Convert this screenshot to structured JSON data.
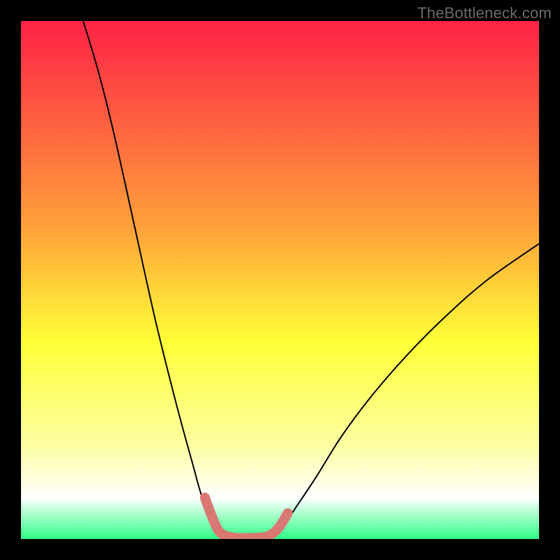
{
  "watermark": "TheBottleneck.com",
  "chart_data": {
    "type": "line",
    "title": "",
    "xlabel": "",
    "ylabel": "",
    "xlim": [
      0,
      100
    ],
    "ylim": [
      0,
      100
    ],
    "background_gradient": {
      "top": "#fe2245",
      "mid1": "#ffa23a",
      "mid2": "#ffff37",
      "mid3": "#fdffa2",
      "bottom": "#2eff86"
    },
    "series": [
      {
        "name": "curve",
        "color": "#000000",
        "stroke_width": 2,
        "points": [
          {
            "x": 12,
            "y": 100
          },
          {
            "x": 15,
            "y": 90
          },
          {
            "x": 18,
            "y": 78
          },
          {
            "x": 22,
            "y": 60
          },
          {
            "x": 26,
            "y": 42
          },
          {
            "x": 30,
            "y": 26
          },
          {
            "x": 33,
            "y": 15
          },
          {
            "x": 35,
            "y": 8
          },
          {
            "x": 37,
            "y": 4
          },
          {
            "x": 39,
            "y": 1
          },
          {
            "x": 41,
            "y": 0
          },
          {
            "x": 44,
            "y": 0
          },
          {
            "x": 47,
            "y": 0
          },
          {
            "x": 49,
            "y": 1
          },
          {
            "x": 51,
            "y": 3
          },
          {
            "x": 53,
            "y": 6
          },
          {
            "x": 57,
            "y": 12
          },
          {
            "x": 62,
            "y": 20
          },
          {
            "x": 68,
            "y": 28
          },
          {
            "x": 75,
            "y": 36
          },
          {
            "x": 82,
            "y": 43
          },
          {
            "x": 90,
            "y": 50
          },
          {
            "x": 100,
            "y": 57
          }
        ]
      },
      {
        "name": "highlight",
        "color": "#d97773",
        "stroke_width": 14,
        "stroke_linecap": "round",
        "points": [
          {
            "x": 35.5,
            "y": 8
          },
          {
            "x": 37,
            "y": 4
          },
          {
            "x": 38.5,
            "y": 1.2
          },
          {
            "x": 41,
            "y": 0.3
          },
          {
            "x": 44,
            "y": 0.2
          },
          {
            "x": 47,
            "y": 0.4
          },
          {
            "x": 48.5,
            "y": 1
          },
          {
            "x": 50,
            "y": 2.5
          },
          {
            "x": 51.5,
            "y": 5
          }
        ]
      }
    ]
  }
}
